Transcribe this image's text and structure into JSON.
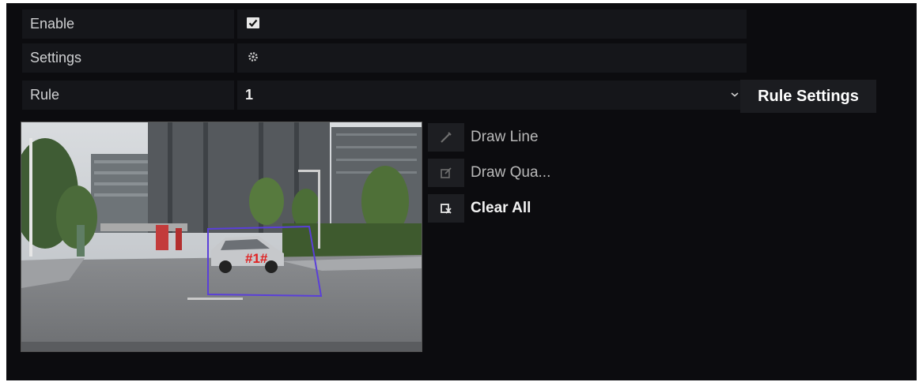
{
  "settings": {
    "enable": {
      "label": "Enable",
      "checked": true,
      "icon": "checkbox-checked-icon"
    },
    "settings_row": {
      "label": "Settings",
      "icon": "gear-icon"
    },
    "rule": {
      "label": "Rule",
      "value": "1",
      "icon": "chevron-down-icon"
    }
  },
  "rule_settings_button": {
    "label": "Rule Settings"
  },
  "video": {
    "region_label": "#1#",
    "region_color": "#5a3fd9",
    "label_color": "#e02020"
  },
  "tools": [
    {
      "label": "Draw Line",
      "icon": "draw-line-icon",
      "enabled": false
    },
    {
      "label": "Draw Qua...",
      "icon": "draw-quadrilateral-icon",
      "enabled": false
    },
    {
      "label": "Clear All",
      "icon": "clear-all-icon",
      "enabled": true
    }
  ],
  "colors": {
    "panel_bg": "#0c0c0f",
    "cell_bg": "#15161a",
    "text": "#cfd0d2"
  }
}
